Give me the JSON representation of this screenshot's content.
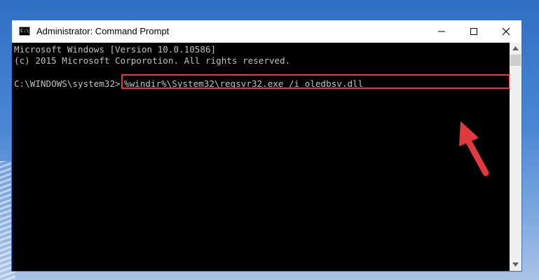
{
  "window": {
    "title": "Administrator: Command Prompt",
    "icon_label": "C:\\"
  },
  "console": {
    "line1": "Microsoft Windows [Version 10.0.10586]",
    "line2": "(c) 2015 Microsoft Corporotion. All rights reserved.",
    "prompt": "C:\\WINDOWS\\system32>",
    "command": "%windir%\\System32\\regsvr32.exe /i oledbsv.dll"
  },
  "icons": {
    "minimize": "minimize-icon",
    "maximize": "maximize-icon",
    "close": "close-icon",
    "arrow": "red-arrow-icon"
  },
  "colors": {
    "highlight": "#e0393e",
    "console_bg": "#000000",
    "console_text": "#c0c0c0"
  }
}
